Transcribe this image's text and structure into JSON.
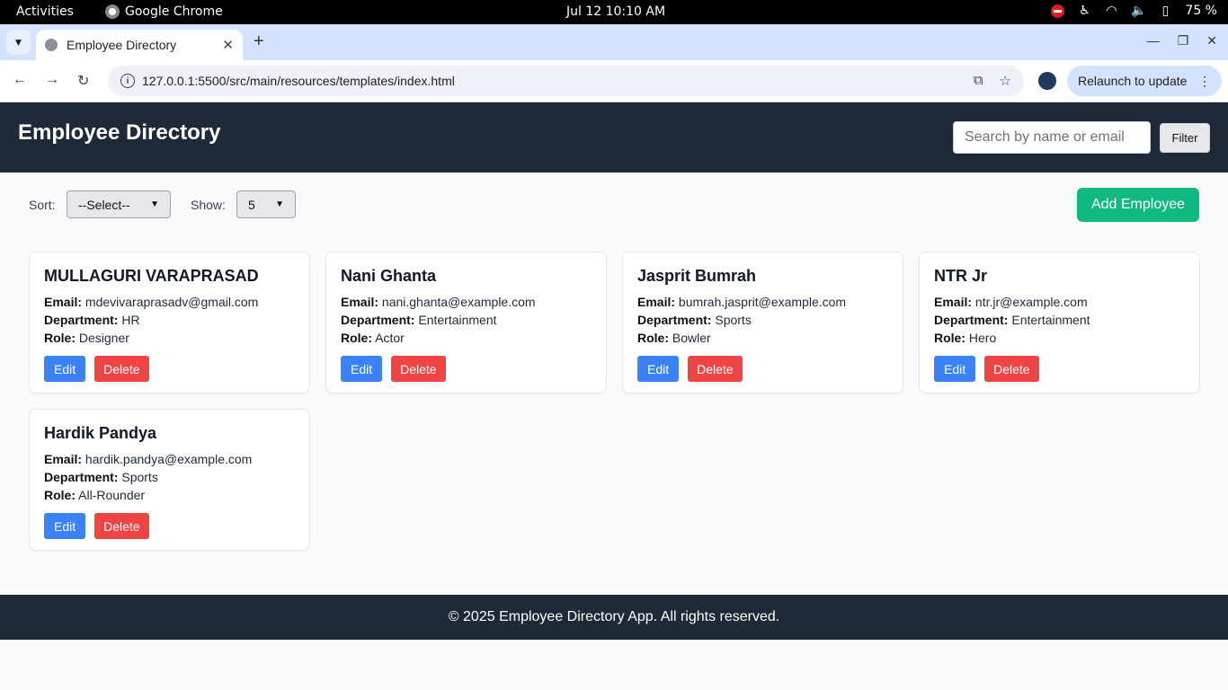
{
  "os": {
    "activities": "Activities",
    "app_name": "Google Chrome",
    "clock": "Jul 12  10:10 AM",
    "battery": "75 %"
  },
  "browser": {
    "tab_title": "Employee Directory",
    "url": "127.0.0.1:5500/src/main/resources/templates/index.html",
    "relaunch_label": "Relaunch to update"
  },
  "header": {
    "title": "Employee Directory",
    "search_placeholder": "Search by name or email",
    "filter_label": "Filter"
  },
  "controls": {
    "sort_label": "Sort:",
    "sort_value": "--Select--",
    "show_label": "Show:",
    "show_value": "5",
    "add_label": "Add Employee"
  },
  "field_labels": {
    "email": "Email:",
    "department": "Department:",
    "role": "Role:"
  },
  "actions": {
    "edit": "Edit",
    "delete": "Delete"
  },
  "employees": [
    {
      "name": "MULLAGURI VARAPRASAD",
      "email": "mdevivaraprasadv@gmail.com",
      "department": "HR",
      "role": "Designer"
    },
    {
      "name": "Nani Ghanta",
      "email": "nani.ghanta@example.com",
      "department": "Entertainment",
      "role": "Actor"
    },
    {
      "name": "Jasprit Bumrah",
      "email": "bumrah.jasprit@example.com",
      "department": "Sports",
      "role": "Bowler"
    },
    {
      "name": "NTR Jr",
      "email": "ntr.jr@example.com",
      "department": "Entertainment",
      "role": "Hero"
    },
    {
      "name": "Hardik Pandya",
      "email": "hardik.pandya@example.com",
      "department": "Sports",
      "role": "All-Rounder"
    }
  ],
  "footer": {
    "text": "© 2025 Employee Directory App. All rights reserved."
  }
}
